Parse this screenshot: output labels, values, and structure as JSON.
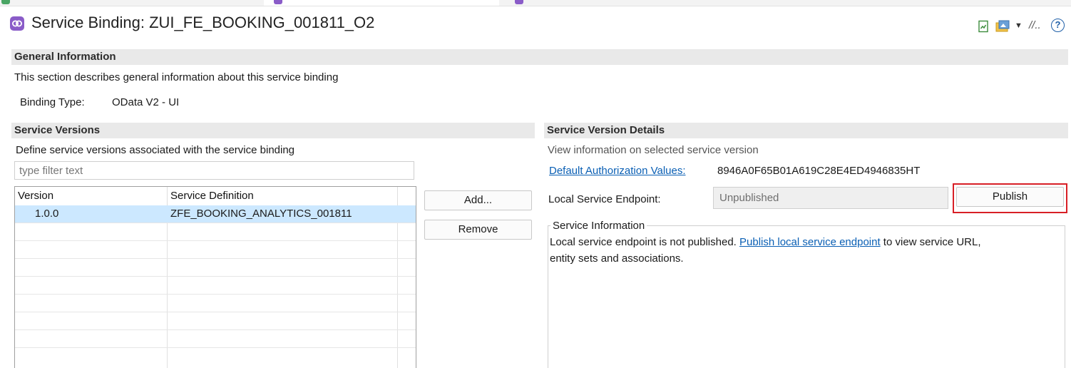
{
  "window": {
    "title": "Service Binding: ZUI_FE_BOOKING_001811_O2"
  },
  "colors": {
    "section_bar": "#e9e9e9",
    "selected_row": "#cce8ff",
    "link": "#0a5fb4",
    "highlight_outline": "#d81f26",
    "binding_icon": "#8a5cc8"
  },
  "toolbar": {
    "icons": [
      "green-document-icon",
      "image-folder-icon",
      "dropdown-arrow-icon",
      "link-icon",
      "help-icon"
    ]
  },
  "general": {
    "title": "General Information",
    "description": "This section describes general information about this service binding",
    "binding_type_label": "Binding Type:",
    "binding_type_value": "OData V2 - UI"
  },
  "versions": {
    "title": "Service Versions",
    "description": "Define service versions associated with the service binding",
    "filter_placeholder": "type filter text",
    "columns": [
      "Version",
      "Service Definition"
    ],
    "rows": [
      {
        "version": "1.0.0",
        "definition": "ZFE_BOOKING_ANALYTICS_001811"
      }
    ],
    "add_label": "Add...",
    "remove_label": "Remove"
  },
  "details": {
    "title": "Service Version Details",
    "description": "View information on selected service version",
    "auth_link": "Default Authorization Values:",
    "auth_value": "8946A0F65B01A619C28E4ED4946835HT",
    "endpoint_label": "Local Service Endpoint:",
    "endpoint_value": "Unpublished",
    "publish_label": "Publish",
    "info_title": "Service Information",
    "info_prefix": "Local service endpoint is not published. ",
    "info_link": "Publish local service endpoint",
    "info_suffix": " to view service URL,",
    "info_line2": "entity sets and associations."
  }
}
